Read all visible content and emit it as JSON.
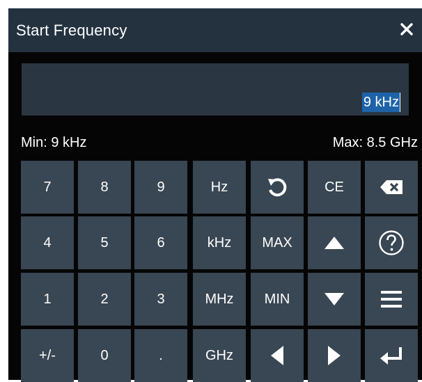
{
  "dialog": {
    "title": "Start Frequency",
    "close_icon": "close-icon"
  },
  "entry": {
    "value": "9 kHz"
  },
  "limits": {
    "min": "Min: 9 kHz",
    "max": "Max: 8.5 GHz"
  },
  "keys": {
    "k7": "7",
    "k8": "8",
    "k9": "9",
    "hz": "Hz",
    "undo": "undo-icon",
    "ce": "CE",
    "backspace": "backspace-icon",
    "k4": "4",
    "k5": "5",
    "k6": "6",
    "khz": "kHz",
    "max": "MAX",
    "up": "arrow-up-icon",
    "help": "help-icon",
    "k1": "1",
    "k2": "2",
    "k3": "3",
    "mhz": "MHz",
    "min": "MIN",
    "down": "arrow-down-icon",
    "menu": "menu-icon",
    "sign": "+/-",
    "k0": "0",
    "dot": ".",
    "ghz": "GHz",
    "left": "arrow-left-icon",
    "right": "arrow-right-icon",
    "enter": "enter-icon"
  },
  "colors": {
    "title_bar": "#243240",
    "key_background": "#394653",
    "entry_background": "#2a3642",
    "selection": "#1e63a8"
  }
}
